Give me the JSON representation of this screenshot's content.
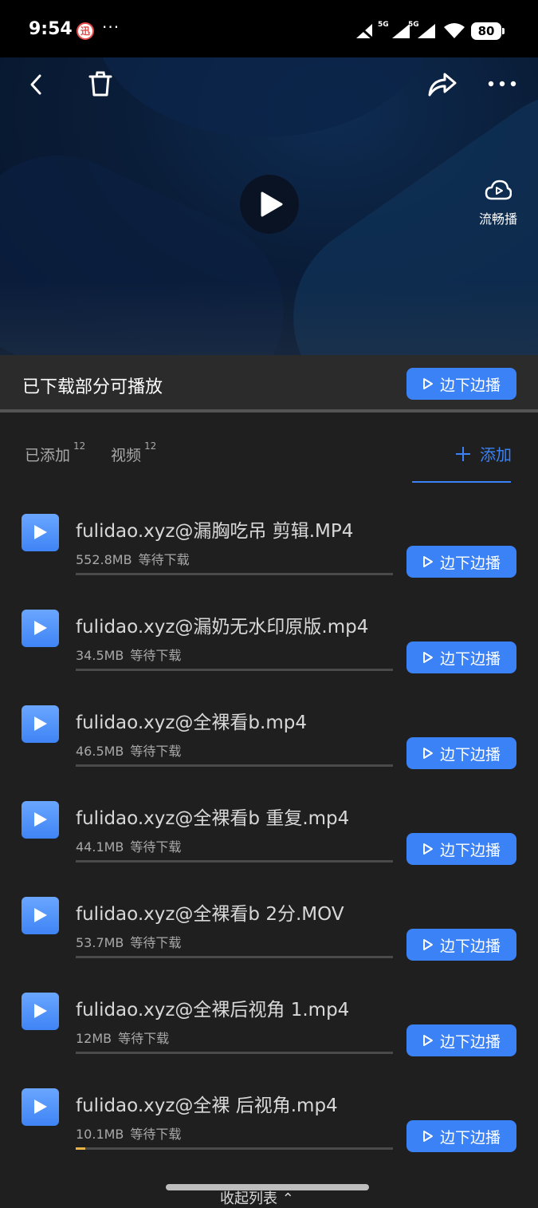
{
  "status_bar": {
    "time": "9:54",
    "notif_badge": "迅",
    "more_dots": "···",
    "battery": "80",
    "network_1": "5G",
    "network_2": "5G"
  },
  "video": {
    "smooth_play_label": "流畅播"
  },
  "partial_banner": {
    "text": "已下载部分可播放",
    "button_label": "边下边播"
  },
  "tabs": [
    {
      "label": "已添加",
      "count": "12"
    },
    {
      "label": "视频",
      "count": "12"
    }
  ],
  "add_label": "添加",
  "items": [
    {
      "name": "fulidao.xyz@漏胸吃吊 剪辑.MP4",
      "size": "552.8MB",
      "status": "等待下载",
      "progress": 0,
      "button": "边下边播"
    },
    {
      "name": "fulidao.xyz@漏奶无水印原版.mp4",
      "size": "34.5MB",
      "status": "等待下载",
      "progress": 0,
      "button": "边下边播"
    },
    {
      "name": "fulidao.xyz@全裸看b.mp4",
      "size": "46.5MB",
      "status": "等待下载",
      "progress": 0,
      "button": "边下边播"
    },
    {
      "name": "fulidao.xyz@全裸看b 重复.mp4",
      "size": "44.1MB",
      "status": "等待下载",
      "progress": 0,
      "button": "边下边播"
    },
    {
      "name": "fulidao.xyz@全裸看b 2分.MOV",
      "size": "53.7MB",
      "status": "等待下载",
      "progress": 0,
      "button": "边下边播"
    },
    {
      "name": "fulidao.xyz@全裸后视角 1.mp4",
      "size": "12MB",
      "status": "等待下载",
      "progress": 0,
      "button": "边下边播"
    },
    {
      "name": "fulidao.xyz@全裸 后视角.mp4",
      "size": "10.1MB",
      "status": "等待下载",
      "progress": 0.03,
      "button": "边下边播"
    }
  ],
  "collapse_label": "收起列表 ⌃",
  "colors": {
    "accent": "#3a82f6",
    "progress_fill": "#e8b44a"
  },
  "icons": [
    "back-icon",
    "trash-icon",
    "share-icon",
    "more-icon",
    "play-icon",
    "cloud-play-icon",
    "plus-icon"
  ]
}
